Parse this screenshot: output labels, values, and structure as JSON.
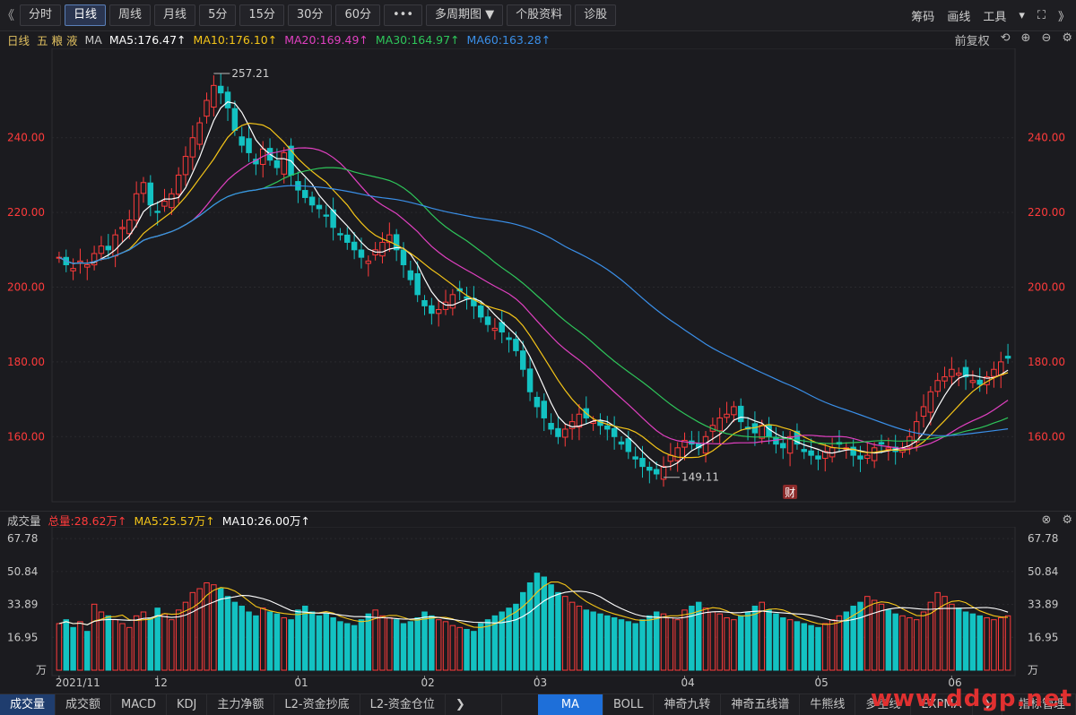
{
  "toolbar": {
    "left_arrow": "《",
    "buttons": [
      "分时",
      "日线",
      "周线",
      "月线",
      "5分",
      "15分",
      "30分",
      "60分",
      "•••",
      "多周期图 ▼",
      "个股资料",
      "诊股"
    ],
    "active_index": 1,
    "right": [
      "筹码",
      "画线",
      "工具",
      "▾",
      "⛶"
    ],
    "right_arrow": "》"
  },
  "ma_bar": {
    "period": "日线",
    "stock": "五 粮 液",
    "indicator": "MA",
    "items": [
      {
        "label": "MA5:176.47↑",
        "color": "#ffffff"
      },
      {
        "label": "MA10:176.10↑",
        "color": "#f5c518"
      },
      {
        "label": "MA20:169.49↑",
        "color": "#e040c0"
      },
      {
        "label": "MA30:164.97↑",
        "color": "#2ec65a"
      },
      {
        "label": "MA60:163.28↑",
        "color": "#3a8fe8"
      }
    ],
    "adjust": "前复权",
    "icons": [
      "⟲",
      "⊕",
      "⊖",
      "⚙"
    ]
  },
  "vol_bar": {
    "title": "成交量",
    "total": "总量:28.62万↑",
    "ma5": "MA5:25.57万↑",
    "ma10": "MA10:26.00万↑",
    "icons": [
      "⊗",
      "⚙"
    ]
  },
  "tabs": {
    "left": [
      "成交量",
      "成交额",
      "MACD",
      "KDJ",
      "主力净额",
      "L2-资金抄底",
      "L2-资金仓位"
    ],
    "more": "❯",
    "right": [
      "MA",
      "BOLL",
      "神奇九转",
      "神奇五线谱",
      "牛熊线",
      "多空线",
      "EXPMA",
      "❯"
    ],
    "manage": "指标管理"
  },
  "watermark": "www.ddgp.net",
  "chart_data": {
    "type": "candlestick",
    "price_axis": {
      "min": 144,
      "max": 262,
      "ticks": [
        160,
        180,
        200,
        220,
        240
      ]
    },
    "volume_axis": {
      "min": 0,
      "max": 72,
      "ticks": [
        16.95,
        33.89,
        50.84,
        67.78
      ],
      "unit": "万"
    },
    "x_labels": [
      {
        "label": "2021/11",
        "i": 0
      },
      {
        "label": "12",
        "i": 14
      },
      {
        "label": "01",
        "i": 34
      },
      {
        "label": "02",
        "i": 52
      },
      {
        "label": "03",
        "i": 68
      },
      {
        "label": "04",
        "i": 89
      },
      {
        "label": "05",
        "i": 108
      },
      {
        "label": "06",
        "i": 127
      }
    ],
    "annotations": [
      {
        "text": "257.21",
        "i": 22,
        "price": 257.21
      },
      {
        "text": "149.11",
        "i": 86,
        "price": 149.11
      }
    ],
    "badge": {
      "text": "财",
      "i": 104
    },
    "ma_colors": {
      "ma5": "#ffffff",
      "ma10": "#f5c518",
      "ma20": "#e040c0",
      "ma30": "#2ec65a",
      "ma60": "#3a8fe8"
    },
    "close": [
      208,
      206,
      205,
      207,
      206,
      209,
      211,
      210,
      214,
      216,
      218,
      225,
      228,
      222,
      220,
      223,
      225,
      230,
      235,
      240,
      244,
      250,
      254,
      252,
      248,
      242,
      238,
      236,
      233,
      237,
      234,
      232,
      236,
      230,
      226,
      224,
      222,
      221,
      219,
      216,
      214,
      212,
      210,
      208,
      207,
      210,
      212,
      214,
      210,
      206,
      202,
      198,
      195,
      193,
      194,
      196,
      198,
      199,
      197,
      195,
      192,
      190,
      189,
      188,
      186,
      183,
      178,
      172,
      168,
      165,
      162,
      160,
      162,
      164,
      166,
      165,
      164,
      163,
      162,
      160,
      158,
      156,
      154,
      152,
      151,
      150,
      152,
      155,
      157,
      159,
      158,
      157,
      160,
      163,
      165,
      166,
      168,
      164,
      162,
      161,
      163,
      160,
      158,
      157,
      160,
      158,
      156,
      155,
      154,
      156,
      157,
      158,
      157,
      155,
      154,
      155,
      157,
      158,
      157,
      156,
      157,
      160,
      164,
      168,
      172,
      175,
      176,
      178,
      177,
      176,
      175,
      174,
      176,
      178,
      180,
      181
    ],
    "volume": [
      24,
      26,
      22,
      25,
      20,
      34,
      30,
      28,
      26,
      24,
      22,
      28,
      30,
      27,
      32,
      29,
      26,
      31,
      35,
      40,
      42,
      45,
      44,
      42,
      38,
      35,
      33,
      30,
      28,
      32,
      30,
      29,
      27,
      26,
      31,
      33,
      30,
      28,
      29,
      27,
      25,
      24,
      23,
      26,
      29,
      31,
      28,
      27,
      26,
      24,
      25,
      27,
      30,
      28,
      26,
      25,
      23,
      22,
      21,
      20,
      24,
      26,
      28,
      30,
      32,
      34,
      40,
      45,
      50,
      48,
      44,
      40,
      38,
      35,
      33,
      31,
      30,
      29,
      28,
      27,
      26,
      25,
      24,
      26,
      28,
      30,
      29,
      27,
      26,
      31,
      33,
      35,
      32,
      30,
      29,
      27,
      26,
      28,
      30,
      33,
      35,
      31,
      29,
      27,
      26,
      25,
      24,
      23,
      22,
      24,
      26,
      28,
      30,
      33,
      35,
      38,
      36,
      34,
      31,
      29,
      28,
      27,
      26,
      30,
      35,
      40,
      38,
      34,
      32,
      30,
      29,
      28,
      27,
      26,
      27,
      28
    ],
    "ma5": [],
    "ma10": [],
    "ma20": [],
    "ma30": [],
    "ma60": []
  }
}
